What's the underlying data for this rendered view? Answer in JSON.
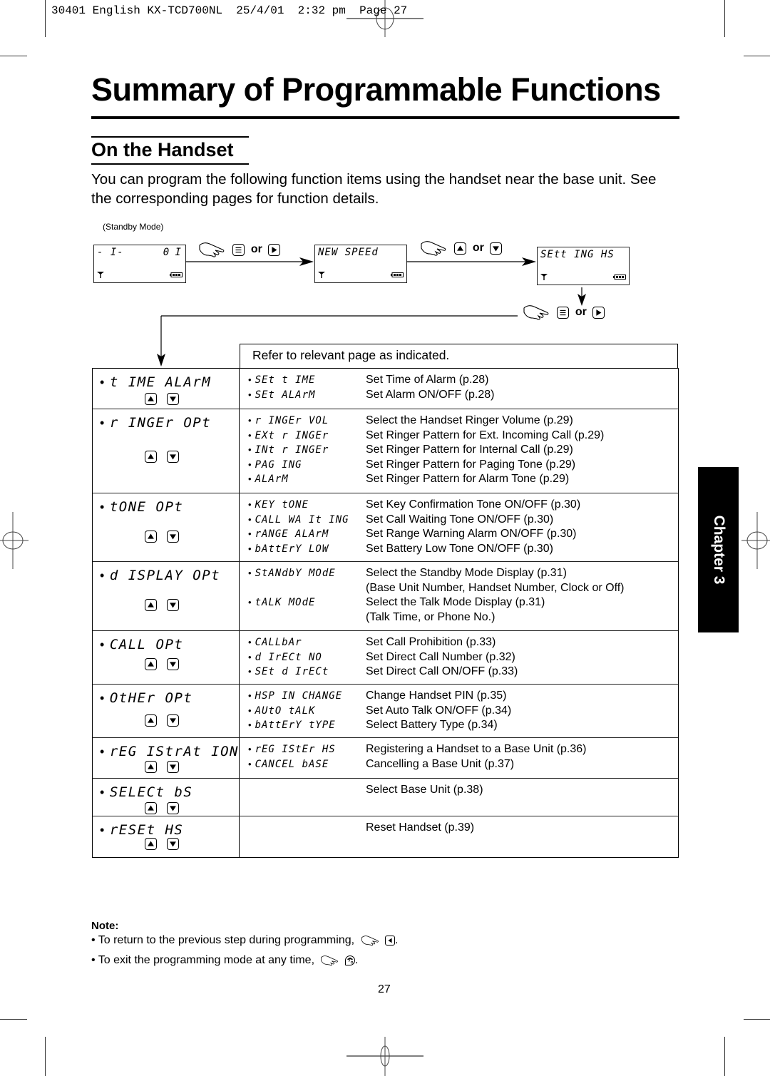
{
  "print_header": "30401 English KX-TCD700NL  25/4/01  2:32 pm  Page 27",
  "title": "Summary of Programmable Functions",
  "section_title": "On the Handset",
  "intro": "You can program the following function items using the handset near the base unit. See the corresponding pages for function details.",
  "flow": {
    "standby_label": "(Standby Mode)",
    "or_label": "or",
    "screens": [
      {
        "left_text": "- I-",
        "right_text": "0 I"
      },
      {
        "left_text": "NEW SPEEd",
        "right_text": ""
      },
      {
        "left_text": "SEtt ING HS",
        "right_text": ""
      }
    ],
    "steps": [
      {
        "icons": [
          "hand-press-icon",
          "menu-key-icon",
          "right-key-icon"
        ]
      },
      {
        "icons": [
          "hand-press-icon",
          "up-key-icon",
          "down-key-icon"
        ]
      },
      {
        "icons": [
          "hand-press-icon",
          "menu-key-icon",
          "right-key-icon"
        ]
      }
    ]
  },
  "table": {
    "header": "Refer to relevant page as indicated.",
    "rows": [
      {
        "menu": "t IME ALArM",
        "items": [
          {
            "name": "SEt t IME",
            "desc": "Set Time of Alarm (p.28)"
          },
          {
            "name": "SEt ALArM",
            "desc": "Set Alarm ON/OFF (p.28)"
          }
        ]
      },
      {
        "menu": "r INGEr OPt",
        "items": [
          {
            "name": "r INGEr VOL",
            "desc": "Select the Handset Ringer Volume (p.29)"
          },
          {
            "name": "EXt r INGEr",
            "desc": "Set Ringer Pattern for Ext. Incoming Call (p.29)"
          },
          {
            "name": "INt r INGEr",
            "desc": "Set Ringer Pattern for Internal Call (p.29)"
          },
          {
            "name": "PAG ING",
            "desc": "Set Ringer Pattern for Paging Tone (p.29)"
          },
          {
            "name": "ALArM",
            "desc": "Set Ringer Pattern for Alarm Tone (p.29)"
          }
        ]
      },
      {
        "menu": "tONE OPt",
        "items": [
          {
            "name": "KEY tONE",
            "desc": "Set Key Confirmation Tone ON/OFF (p.30)"
          },
          {
            "name": "CALL WA It ING",
            "desc": "Set Call Waiting Tone ON/OFF (p.30)"
          },
          {
            "name": "rANGE ALArM",
            "desc": "Set Range Warning Alarm ON/OFF (p.30)"
          },
          {
            "name": "bAttErY LOW",
            "desc": "Set Battery Low Tone ON/OFF (p.30)"
          }
        ]
      },
      {
        "menu": "d ISPLAY OPt",
        "items": [
          {
            "name": "StANdbY MOdE",
            "desc": "Select the Standby Mode Display (p.31)"
          },
          {
            "name": "",
            "desc": "(Base Unit Number, Handset Number, Clock or Off)"
          },
          {
            "name": "tALK MOdE",
            "desc": "Select the Talk Mode Display (p.31)"
          },
          {
            "name": "",
            "desc": "(Talk Time, or Phone No.)"
          }
        ]
      },
      {
        "menu": "CALL OPt",
        "items": [
          {
            "name": "CALLbAr",
            "desc": "Set Call Prohibition (p.33)"
          },
          {
            "name": "d IrECt NO",
            "desc": "Set Direct Call Number (p.32)"
          },
          {
            "name": "SEt d IrECt",
            "desc": "Set Direct Call ON/OFF (p.33)"
          }
        ]
      },
      {
        "menu": "OtHEr OPt",
        "items": [
          {
            "name": "HSP IN CHANGE",
            "desc": "Change Handset PIN (p.35)"
          },
          {
            "name": "AUtO tALK",
            "desc": "Set Auto Talk ON/OFF (p.34)"
          },
          {
            "name": "bAttErY tYPE",
            "desc": "Select Battery Type (p.34)"
          }
        ]
      },
      {
        "menu": "rEG IStrAt ION",
        "items": [
          {
            "name": "rEG IStEr HS",
            "desc": "Registering a Handset to a Base Unit (p.36)"
          },
          {
            "name": "CANCEL bASE",
            "desc": "Cancelling a Base Unit (p.37)"
          }
        ]
      },
      {
        "menu": "SELECt bS",
        "items": [
          {
            "name": "",
            "desc": "Select Base Unit (p.38)"
          }
        ]
      },
      {
        "menu": "rESEt HS",
        "items": [
          {
            "name": "",
            "desc": "Reset Handset (p.39)"
          }
        ]
      }
    ]
  },
  "chapter_tab": "Chapter 3",
  "note": {
    "title": "Note:",
    "lines": [
      {
        "text": "• To return to the previous step during programming,",
        "icons": [
          "hand-press-icon",
          "left-key-icon"
        ],
        "end": "."
      },
      {
        "text": "• To exit the programming mode at any time,",
        "icons": [
          "hand-press-icon",
          "off-hook-key-icon"
        ],
        "end": "."
      }
    ]
  },
  "page_number": "27"
}
